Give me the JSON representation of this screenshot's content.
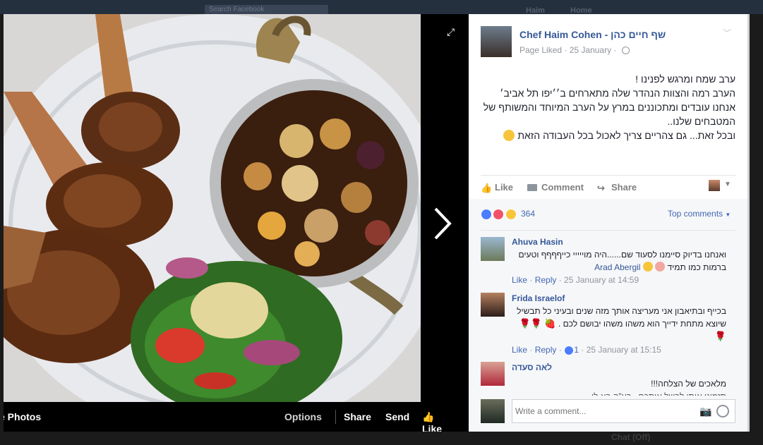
{
  "background": {
    "search_placeholder": "Search Facebook",
    "header_right": [
      "Haim",
      "Home"
    ],
    "chat_status": "Chat (Off)"
  },
  "photo_viewer": {
    "bar": {
      "photos": "e Photos",
      "options": "Options",
      "share": "Share",
      "send": "Send",
      "like": "Like"
    }
  },
  "post": {
    "page_name": "Chef Haim Cohen - שף חיים כהן",
    "liked": "Page Liked",
    "date": "25 January",
    "text_lines": [
      "ערב שמח ומרגש לפנינו !",
      "הערב רמה והצוות הנהדר שלה מתארחים ב׳׳יפו תל אביב׳",
      "אנחנו עובדים ומתכוננים במרץ על הערב המיוחד והמשותף של המטבחים שלנו..",
      "ובכל זאת... גם צהריים צריך לאכול בכל העבודה הזאת"
    ],
    "actions": {
      "like": "Like",
      "comment": "Comment",
      "share": "Share"
    },
    "reaction_count": "364",
    "top_comments": "Top comments"
  },
  "comments": [
    {
      "name": "Ahuva Hasin",
      "text": "ואנחנו בדיוק סיימנו לסעוד שם......היה מוייייי כייףףףף וטעים ברמות כמו תמיד",
      "tag": "Arad Abergil",
      "like": "Like",
      "reply": "Reply",
      "time": "25 January at 14:59"
    },
    {
      "name": "Frida Israelof",
      "text": "בכייף ובתיאבון אני מעריצה אותך מזה שנים ובעיני כל תבשיל שיוצא מתחת ידייך הוא משהו משהו יבושם לכם .",
      "like": "Like",
      "reply": "Reply",
      "likes": "1",
      "time": "25 January at 15:15"
    },
    {
      "name": "לאה סעדה",
      "text": "מלאכים של הצלחה!!!",
      "text2": "תזמינו אותי לבשל איתכם.. בע\"ה בא לי"
    }
  ],
  "write_comment": {
    "placeholder": "Write a comment..."
  },
  "colors": {
    "link": "#365899",
    "accent": "#4267b2",
    "muted": "#90949c"
  }
}
